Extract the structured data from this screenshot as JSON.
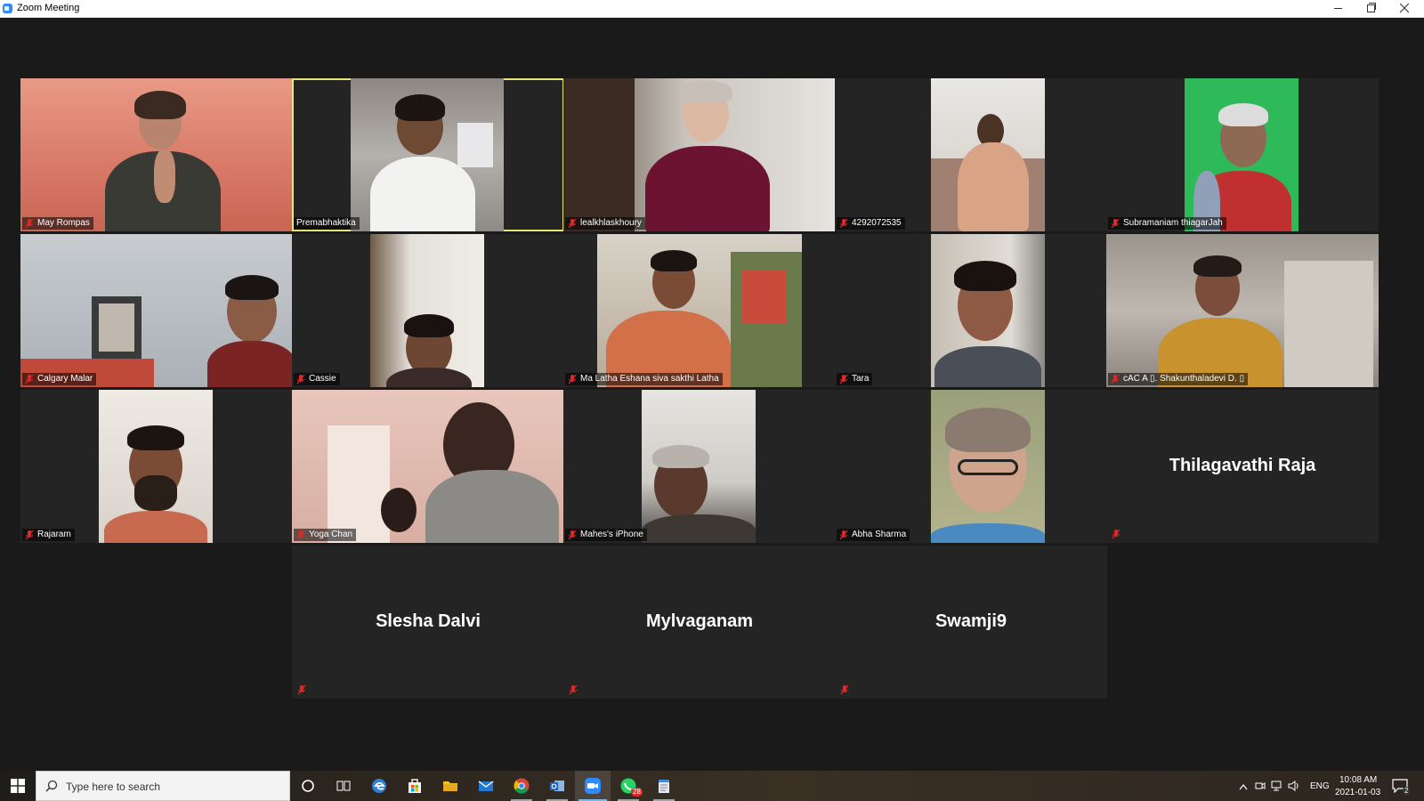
{
  "window": {
    "title": "Zoom Meeting"
  },
  "tiles": [
    {
      "name": "May Rompas",
      "muted": true,
      "active": false,
      "has_video": true
    },
    {
      "name": "Premabhaktika",
      "muted": false,
      "active": true,
      "has_video": true
    },
    {
      "name": "lealkhlaskhoury",
      "muted": true,
      "active": false,
      "has_video": true
    },
    {
      "name": "4292072535",
      "muted": true,
      "active": false,
      "has_video": true
    },
    {
      "name": "Subramaniam thiagarJah",
      "muted": true,
      "active": false,
      "has_video": true
    },
    {
      "name": "Calgary Malar",
      "muted": true,
      "active": false,
      "has_video": true
    },
    {
      "name": "Cassie",
      "muted": true,
      "active": false,
      "has_video": true
    },
    {
      "name": "Ma Latha Eshana siva sakthi Latha",
      "muted": true,
      "active": false,
      "has_video": true
    },
    {
      "name": "Tara",
      "muted": true,
      "active": false,
      "has_video": true
    },
    {
      "name": "cAC A ▯. Shakunthaladevi D.  ▯",
      "muted": true,
      "active": false,
      "has_video": true
    },
    {
      "name": "Rajaram",
      "muted": true,
      "active": false,
      "has_video": true
    },
    {
      "name": "Yoga Chan",
      "muted": true,
      "active": false,
      "has_video": true
    },
    {
      "name": "Mahes's iPhone",
      "muted": true,
      "active": false,
      "has_video": true
    },
    {
      "name": "Abha Sharma",
      "muted": true,
      "active": false,
      "has_video": true
    },
    {
      "name": "Thilagavathi Raja",
      "muted": true,
      "active": false,
      "has_video": false
    },
    {
      "name": "Slesha Dalvi",
      "muted": true,
      "active": false,
      "has_video": false
    },
    {
      "name": "Mylvaganam",
      "muted": true,
      "active": false,
      "has_video": false
    },
    {
      "name": "Swamji9",
      "muted": true,
      "active": false,
      "has_video": false
    }
  ],
  "taskbar": {
    "search_placeholder": "Type here to search",
    "apps": [
      "cortana-icon",
      "task-view-icon",
      "edge-icon",
      "store-icon",
      "file-explorer-icon",
      "mail-icon",
      "chrome-icon",
      "outlook-icon",
      "zoom-icon",
      "whatsapp-icon",
      "notepad-icon"
    ],
    "whatsapp_badge": "28",
    "language": "ENG",
    "time": "10:08 AM",
    "date": "2021-01-03",
    "notification_count": "2"
  },
  "colors": {
    "active_speaker_border": "#e8e67a",
    "mute_red": "#e02828",
    "tile_bg": "#242424"
  }
}
